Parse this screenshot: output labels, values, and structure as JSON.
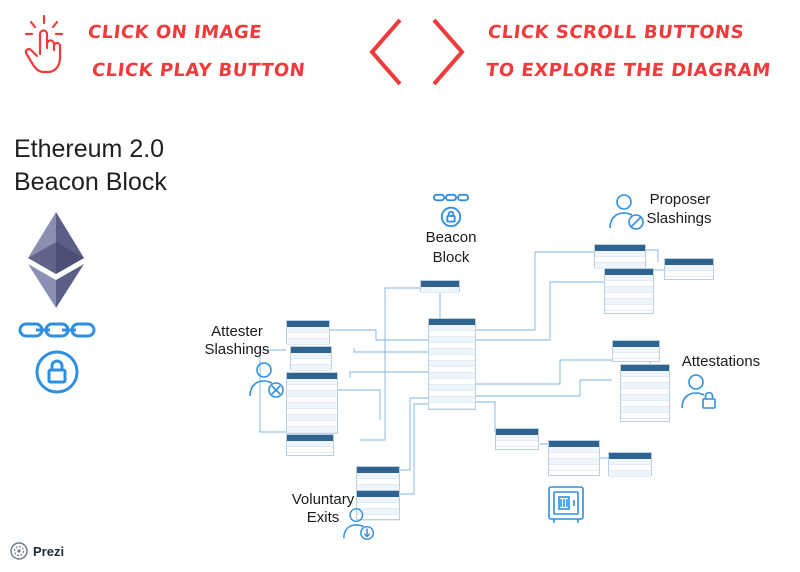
{
  "instructions": {
    "line1": "CLICK ON IMAGE",
    "line2": "CLICK PLAY BUTTON",
    "line3": "CLICK SCROLL BUTTONS",
    "line4": "TO EXPLORE THE DIAGRAM"
  },
  "title": {
    "line1": "Ethereum 2.0",
    "line2": "Beacon Block"
  },
  "labels": {
    "beacon_block_1": "Beacon",
    "beacon_block_2": "Block",
    "proposer_1": "Proposer",
    "proposer_2": "Slashings",
    "attester_1": "Attester",
    "attester_2": "Slashings",
    "attestations": "Attestations",
    "voluntary_1": "Voluntary",
    "voluntary_2": "Exits"
  },
  "brand": {
    "name": "Prezi"
  },
  "colors": {
    "accent_red": "#ef3b3b",
    "diagram_blue": "#2f8fe0",
    "table_header": "#30638f"
  },
  "icons": [
    "tap-hand-icon",
    "chevron-left-icon",
    "chevron-right-icon",
    "ethereum-logo-icon",
    "chain-lock-icon",
    "person-x-icon",
    "person-slash-icon",
    "person-lock-icon",
    "person-arrow-icon",
    "safe-icon",
    "prezi-logo-icon"
  ]
}
